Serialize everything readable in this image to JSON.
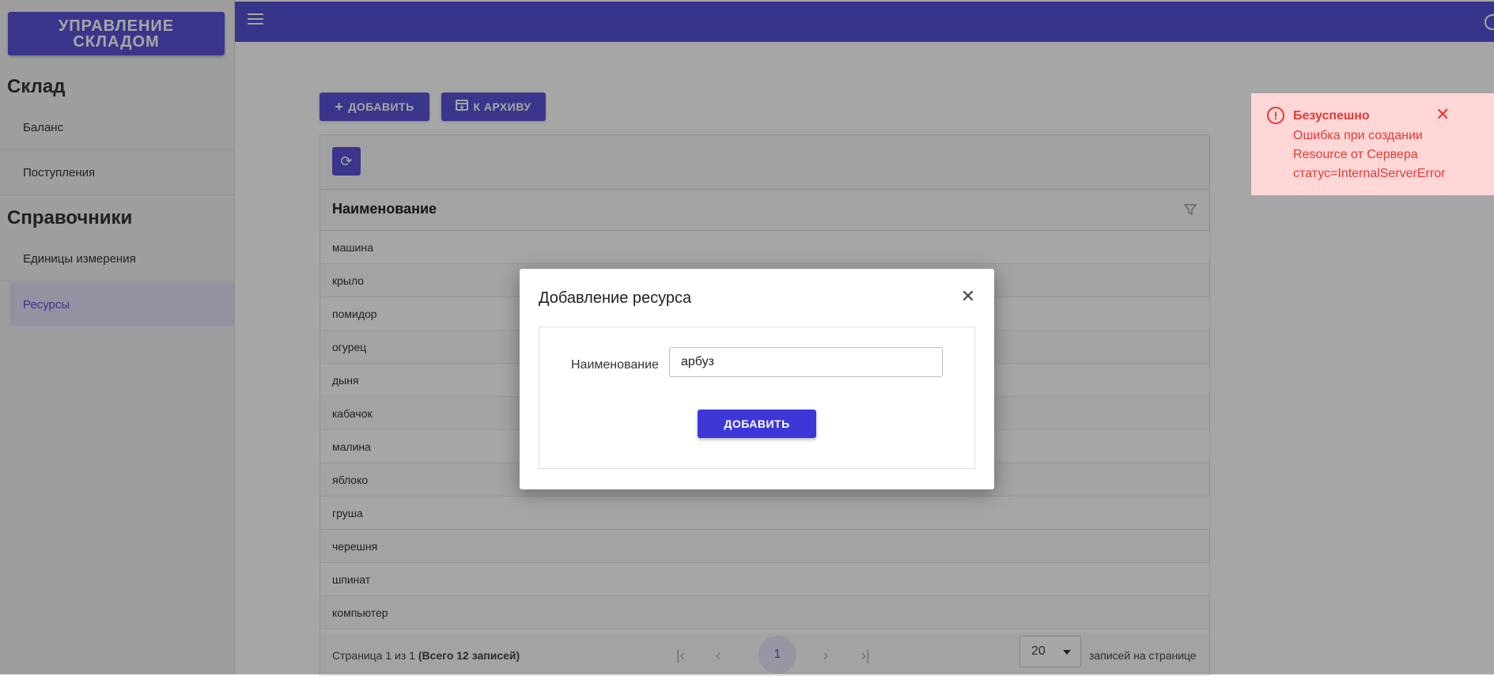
{
  "app": {
    "logo": "УПРАВЛЕНИЕ СКЛАДОМ"
  },
  "sidebar": {
    "sections": [
      {
        "title": "Склад",
        "items": [
          {
            "label": "Баланс"
          },
          {
            "label": "Поступления"
          }
        ]
      },
      {
        "title": "Справочники",
        "items": [
          {
            "label": "Единицы измерения"
          },
          {
            "label": "Ресурсы",
            "active": true
          }
        ]
      }
    ]
  },
  "toolbar": {
    "add_label": "ДОБАВИТЬ",
    "archive_label": "К АРХИВУ"
  },
  "grid": {
    "column": "Наименование",
    "rows": [
      "машина",
      "крыло",
      "помидор",
      "огурец",
      "дыня",
      "кабачок",
      "малина",
      "яблоко",
      "груша",
      "черешня",
      "шпинат",
      "компьютер"
    ],
    "pager": {
      "info_prefix": "Страница 1 из 1",
      "info_bold": "(Всего 12 записей)",
      "current_page": "1",
      "page_size": "20",
      "per_page_label": "записей на странице"
    }
  },
  "dialog": {
    "title": "Добавление ресурса",
    "field_label": "Наименование",
    "field_value": "арбуз",
    "submit_label": "ДОБАВИТЬ"
  },
  "toast": {
    "title": "Безуспешно",
    "message": "Ошибка при создании Resource от Сервера статус=InternalServerError"
  },
  "colors": {
    "accent": "#5b54d6",
    "topbar": "#5750d4",
    "error": "#e53935",
    "error_bg": "#ffd7d7"
  }
}
